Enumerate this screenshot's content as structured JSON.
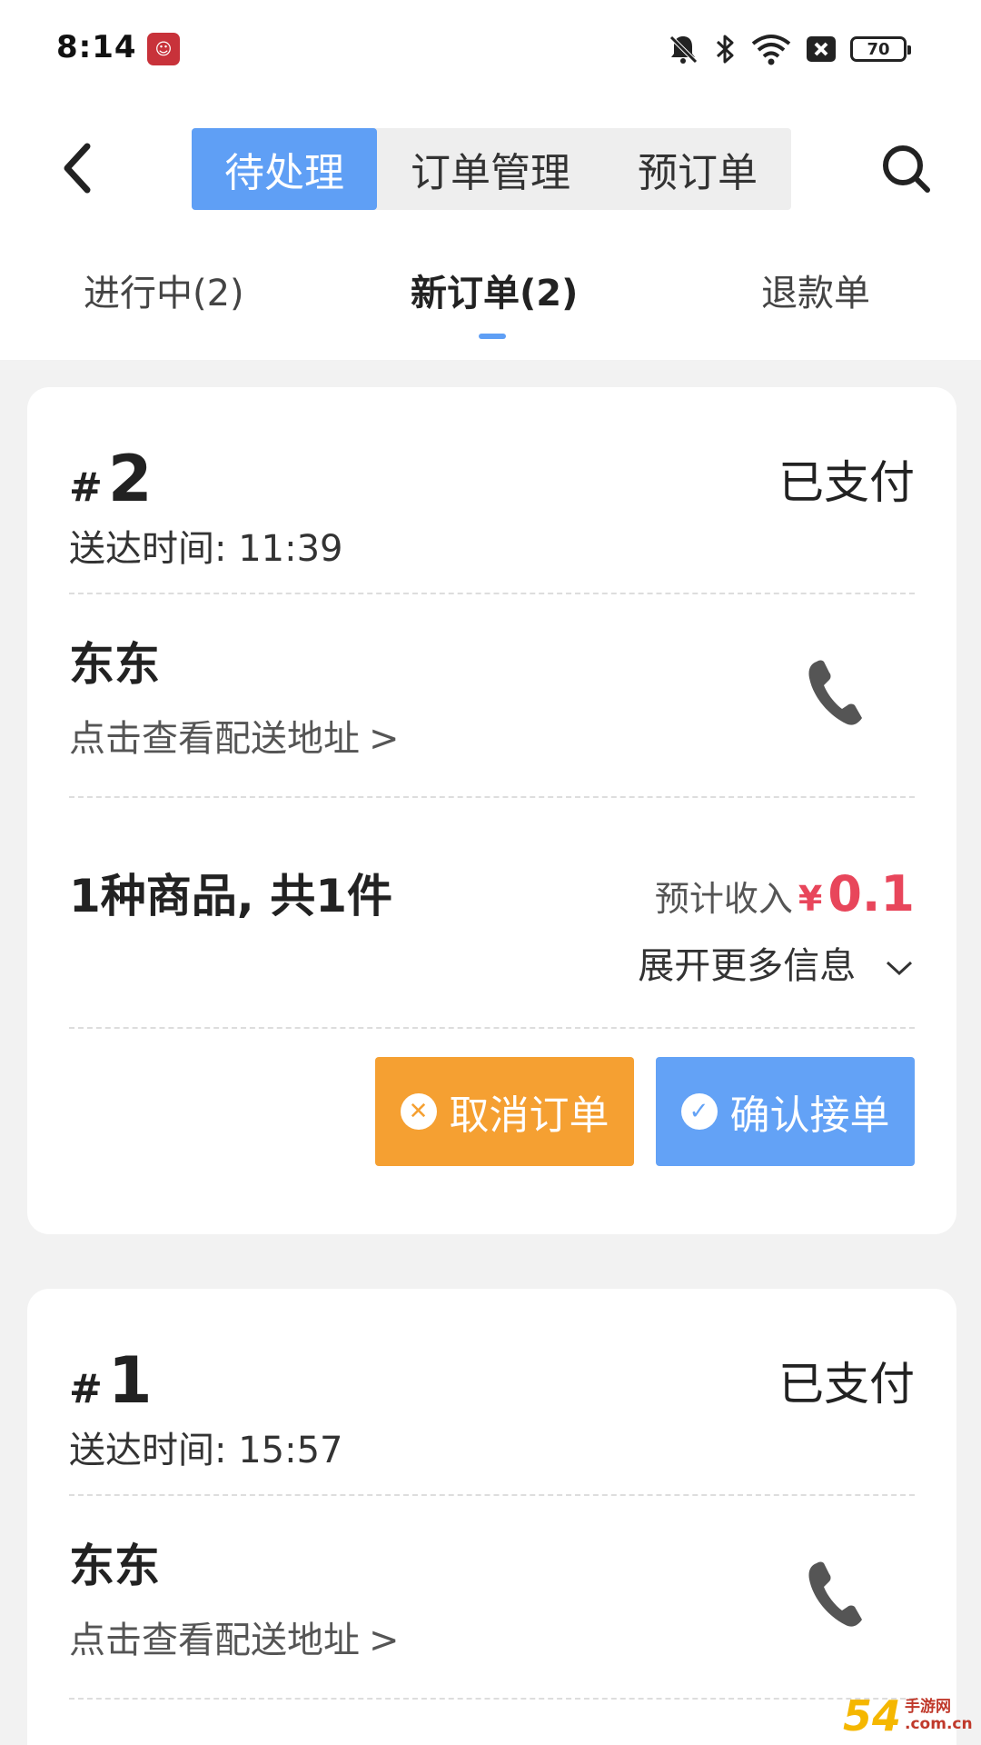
{
  "status_bar": {
    "time": "8:14",
    "battery": "70"
  },
  "header": {
    "tabs": [
      {
        "label": "待处理",
        "active": true
      },
      {
        "label": "订单管理",
        "active": false
      },
      {
        "label": "预订单",
        "active": false
      }
    ]
  },
  "sub_tabs": [
    {
      "label": "进行中(2)",
      "active": false
    },
    {
      "label": "新订单(2)",
      "active": true
    },
    {
      "label": "退款单",
      "active": false
    }
  ],
  "orders": [
    {
      "hash": "#",
      "number": "2",
      "status": "已支付",
      "eta": "送达时间: 11:39",
      "customer": "东东",
      "address_link": "点击查看配送地址",
      "items_summary": "1种商品, 共1件",
      "income_label": "预计收入",
      "currency": "¥",
      "income_amount": "0.1",
      "expand_label": "展开更多信息",
      "cancel_label": "取消订单",
      "confirm_label": "确认接单"
    },
    {
      "hash": "#",
      "number": "1",
      "status": "已支付",
      "eta": "送达时间: 15:57",
      "customer": "东东",
      "address_link": "点击查看配送地址"
    }
  ],
  "watermark": {
    "big": "54",
    "small_line1": "手游网",
    "small_line2": ".com.cn"
  },
  "colors": {
    "accent": "#5f9ff5",
    "cancel": "#f5a032",
    "confirm": "#63a2f6",
    "price": "#e8465b"
  },
  "icons": [
    "app-icon",
    "bell-off-icon",
    "bluetooth-icon",
    "wifi-icon",
    "sim-off-icon",
    "battery-icon",
    "back-arrow-icon",
    "search-icon",
    "phone-icon",
    "chevron-right-icon",
    "chevron-down-icon",
    "close-circle-icon",
    "check-circle-icon"
  ]
}
